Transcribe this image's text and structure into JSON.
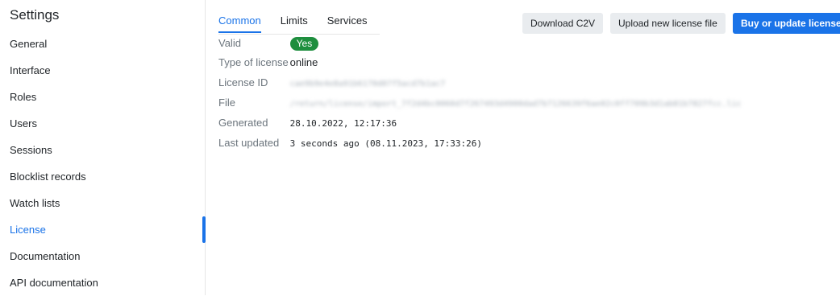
{
  "sidebar": {
    "title": "Settings",
    "items": [
      {
        "label": "General"
      },
      {
        "label": "Interface"
      },
      {
        "label": "Roles"
      },
      {
        "label": "Users"
      },
      {
        "label": "Sessions"
      },
      {
        "label": "Blocklist records"
      },
      {
        "label": "Watch lists"
      },
      {
        "label": "License",
        "active": true
      },
      {
        "label": "Documentation"
      },
      {
        "label": "API documentation"
      }
    ]
  },
  "tabs": [
    {
      "label": "Common",
      "active": true
    },
    {
      "label": "Limits"
    },
    {
      "label": "Services"
    }
  ],
  "toolbar": {
    "download_label": "Download C2V",
    "upload_label": "Upload new license file",
    "buy_label": "Buy or update license"
  },
  "license": {
    "valid_label": "Valid",
    "valid_value": "Yes",
    "type_label": "Type of license",
    "type_value": "online",
    "id_label": "License ID",
    "id_value": "cae9b9e4e8a91b6170d07f5acd7b1ac7",
    "file_label": "File",
    "file_value": "/return/license/import_7f2d4bc0060d7f267493d4900dad7b7126639f6ae02c0ff709b3d1ab81b7827fcc.lic",
    "generated_label": "Generated",
    "generated_value": "28.10.2022, 12:17:36",
    "updated_label": "Last updated",
    "updated_value": "3 seconds ago (08.11.2023, 17:33:26)"
  },
  "colors": {
    "accent": "#1a73e8",
    "valid_badge": "#1e8e3e",
    "secondary_button": "#e9ecef",
    "label_text": "#6c757d"
  }
}
